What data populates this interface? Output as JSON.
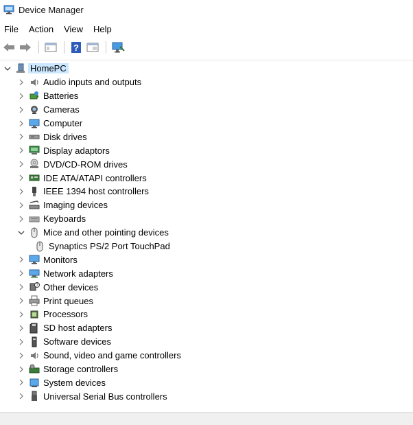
{
  "window": {
    "title": "Device Manager",
    "icon": "device-manager-icon"
  },
  "menu": [
    "File",
    "Action",
    "View",
    "Help"
  ],
  "toolbar": {
    "buttons": [
      "back-arrow-icon",
      "forward-arrow-icon",
      "show-hide-console-tree-icon",
      "help-icon",
      "properties-icon",
      "scan-hardware-icon"
    ]
  },
  "tree": {
    "root": {
      "label": "HomePC",
      "icon": "computer-icon",
      "expanded": true
    },
    "categories": [
      {
        "label": "Audio inputs and outputs",
        "icon": "speaker-icon"
      },
      {
        "label": "Batteries",
        "icon": "battery-icon"
      },
      {
        "label": "Cameras",
        "icon": "camera-icon"
      },
      {
        "label": "Computer",
        "icon": "monitor-icon"
      },
      {
        "label": "Disk drives",
        "icon": "disk-drive-icon"
      },
      {
        "label": "Display adaptors",
        "icon": "display-adapter-icon"
      },
      {
        "label": "DVD/CD-ROM drives",
        "icon": "optical-drive-icon"
      },
      {
        "label": "IDE ATA/ATAPI controllers",
        "icon": "ide-controller-icon"
      },
      {
        "label": "IEEE 1394 host controllers",
        "icon": "firewire-icon"
      },
      {
        "label": "Imaging devices",
        "icon": "scanner-icon"
      },
      {
        "label": "Keyboards",
        "icon": "keyboard-icon"
      },
      {
        "label": "Mice and other pointing devices",
        "icon": "mouse-icon",
        "expanded": true,
        "children": [
          {
            "label": "Synaptics PS/2 Port TouchPad",
            "icon": "mouse-icon"
          }
        ]
      },
      {
        "label": "Monitors",
        "icon": "monitor-icon"
      },
      {
        "label": "Network adapters",
        "icon": "network-adapter-icon"
      },
      {
        "label": "Other devices",
        "icon": "unknown-device-icon"
      },
      {
        "label": "Print queues",
        "icon": "printer-icon"
      },
      {
        "label": "Processors",
        "icon": "processor-icon"
      },
      {
        "label": "SD host adapters",
        "icon": "sd-card-icon"
      },
      {
        "label": "Software devices",
        "icon": "software-device-icon"
      },
      {
        "label": "Sound, video and game controllers",
        "icon": "speaker-icon"
      },
      {
        "label": "Storage controllers",
        "icon": "storage-controller-icon"
      },
      {
        "label": "System devices",
        "icon": "system-device-icon"
      },
      {
        "label": "Universal Serial Bus controllers",
        "icon": "usb-icon"
      }
    ]
  }
}
